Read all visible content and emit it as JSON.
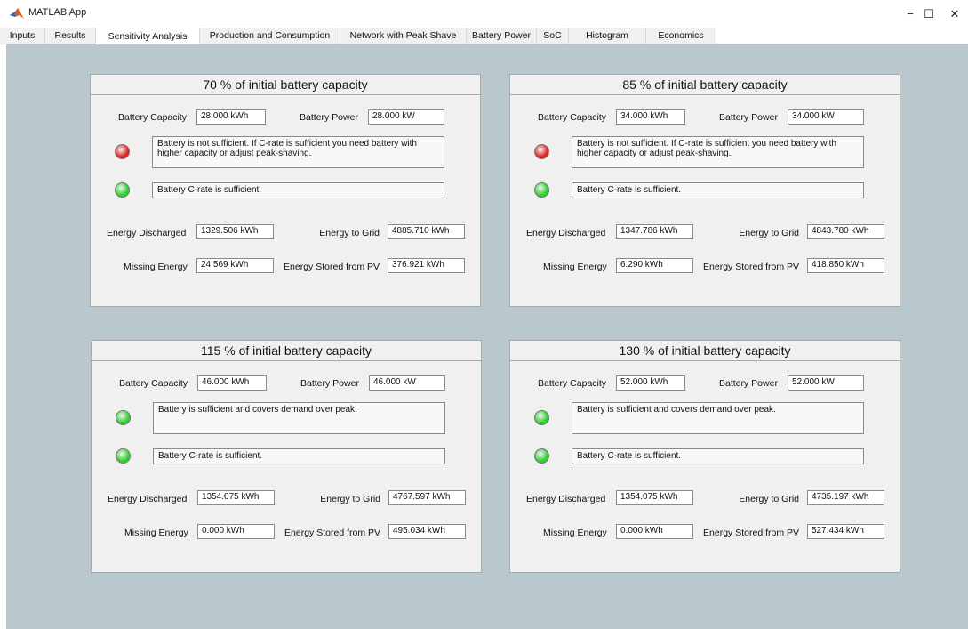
{
  "window": {
    "title": "MATLAB App",
    "minimize": "−",
    "maximize": "☐",
    "close": "✕"
  },
  "tabs": [
    {
      "label": "Inputs"
    },
    {
      "label": "Results"
    },
    {
      "label": "Sensitivity Analysis"
    },
    {
      "label": "Production and Consumption"
    },
    {
      "label": "Network with Peak Shave"
    },
    {
      "label": "Battery Power"
    },
    {
      "label": "SoC"
    },
    {
      "label": "Histogram"
    },
    {
      "label": "Economics"
    }
  ],
  "active_tab": "Sensitivity Analysis",
  "colors": {
    "lamp_red": "#e02020",
    "lamp_green": "#2fd02f",
    "background": "#b8c8cc"
  },
  "labels": {
    "battery_capacity": "Battery Capacity",
    "battery_power": "Battery Power",
    "energy_discharged": "Energy Discharged",
    "energy_to_grid": "Energy to Grid",
    "missing_energy": "Missing Energy",
    "energy_stored_pv": "Energy Stored from PV"
  },
  "panels": [
    {
      "title": "70 % of initial battery capacity",
      "battery_capacity": "28.000 kWh",
      "battery_power": "28.000 kW",
      "capacity_status": "red",
      "capacity_message": "Battery is not sufficient. If C-rate is sufficient you need battery with higher capacity or adjust peak-shaving.",
      "crate_status": "green",
      "crate_message": "Battery C-rate is sufficient.",
      "energy_discharged": "1329.506 kWh",
      "energy_to_grid": "4885.710 kWh",
      "missing_energy": "24.569 kWh",
      "energy_stored_pv": "376.921 kWh"
    },
    {
      "title": "85 % of initial battery capacity",
      "battery_capacity": "34.000 kWh",
      "battery_power": "34.000 kW",
      "capacity_status": "red",
      "capacity_message": "Battery is not sufficient. If C-rate is sufficient you need battery with higher capacity or adjust peak-shaving.",
      "crate_status": "green",
      "crate_message": "Battery C-rate is sufficient.",
      "energy_discharged": "1347.786 kWh",
      "energy_to_grid": "4843.780 kWh",
      "missing_energy": "6.290 kWh",
      "energy_stored_pv": "418.850 kWh"
    },
    {
      "title": "115 % of initial battery capacity",
      "battery_capacity": "46.000 kWh",
      "battery_power": "46.000 kW",
      "capacity_status": "green",
      "capacity_message": "Battery is sufficient and covers demand over peak.",
      "crate_status": "green",
      "crate_message": "Battery C-rate is sufficient.",
      "energy_discharged": "1354.075 kWh",
      "energy_to_grid": "4767.597 kWh",
      "missing_energy": "0.000 kWh",
      "energy_stored_pv": "495.034 kWh"
    },
    {
      "title": "130 % of initial battery capacity",
      "battery_capacity": "52.000 kWh",
      "battery_power": "52.000 kW",
      "capacity_status": "green",
      "capacity_message": "Battery is sufficient and covers demand over peak.",
      "crate_status": "green",
      "crate_message": "Battery C-rate is sufficient.",
      "energy_discharged": "1354.075 kWh",
      "energy_to_grid": "4735.197 kWh",
      "missing_energy": "0.000 kWh",
      "energy_stored_pv": "527.434 kWh"
    }
  ]
}
